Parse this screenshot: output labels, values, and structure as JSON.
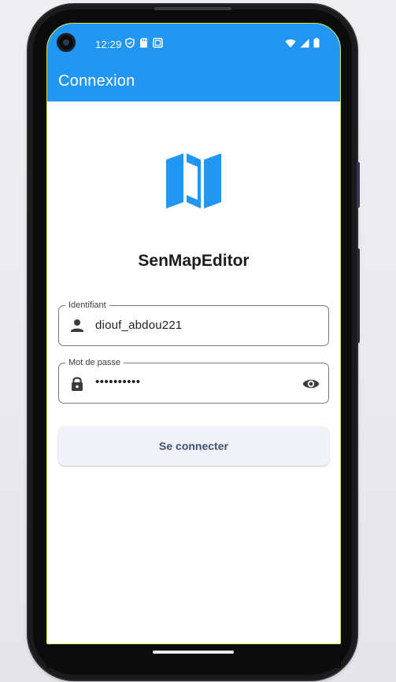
{
  "status_bar": {
    "time": "12:29",
    "icons_left": [
      "shield-icon",
      "sd-card-icon",
      "screenshot-icon"
    ],
    "icons_right": [
      "wifi-icon",
      "cell-signal-icon",
      "battery-icon"
    ]
  },
  "app_bar": {
    "title": "Connexion",
    "color": "#2196f3"
  },
  "logo": {
    "icon": "map-icon",
    "color": "#2196f3"
  },
  "app_name": "SenMapEditor",
  "form": {
    "username": {
      "label": "Identifiant",
      "value": "diouf_abdou221",
      "icon": "person-icon"
    },
    "password": {
      "label": "Mot de passe",
      "masked_value": "••••••••••",
      "icon": "lock-icon",
      "toggle_icon": "eye-icon"
    },
    "submit_label": "Se connecter"
  }
}
